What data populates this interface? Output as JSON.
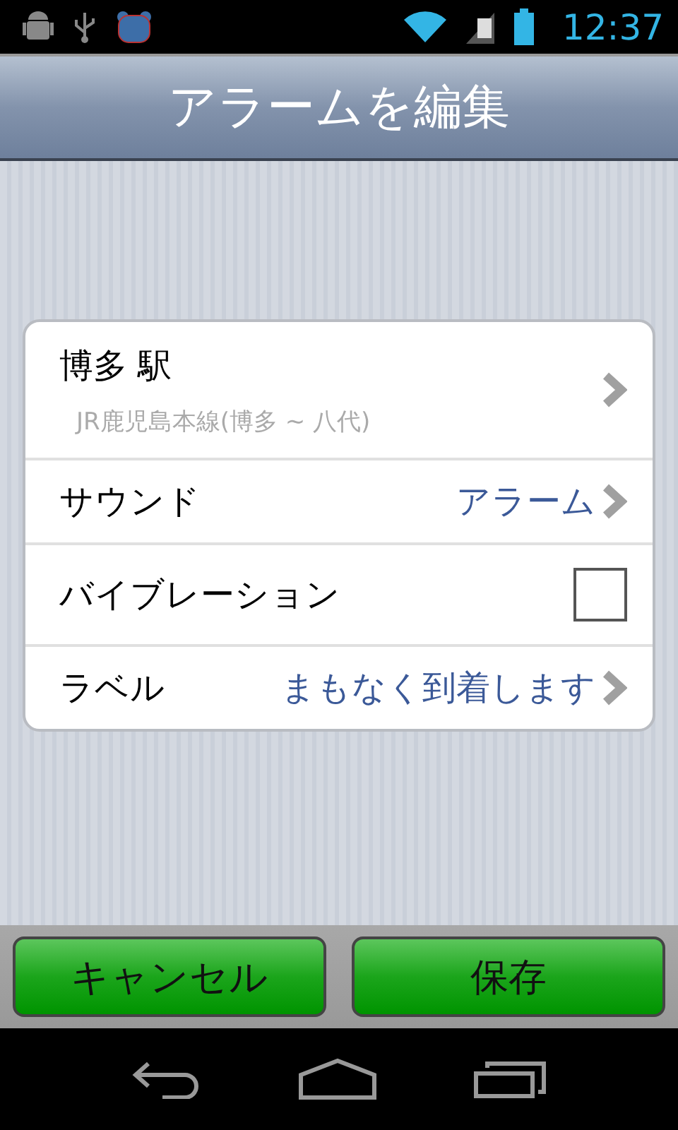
{
  "status_bar": {
    "time": "12:37"
  },
  "title": "アラームを編集",
  "rows": [
    {
      "kind": "station",
      "label": "博多 駅",
      "subtitle": "JR鹿児島本線(博多 ~ 八代)"
    },
    {
      "kind": "value",
      "label": "サウンド",
      "value": "アラーム"
    },
    {
      "kind": "checkbox",
      "label": "バイブレーション",
      "checked": false
    },
    {
      "kind": "value",
      "label": "ラベル",
      "value": "まもなく到着します"
    }
  ],
  "buttons": [
    "キャンセル",
    "保存"
  ]
}
